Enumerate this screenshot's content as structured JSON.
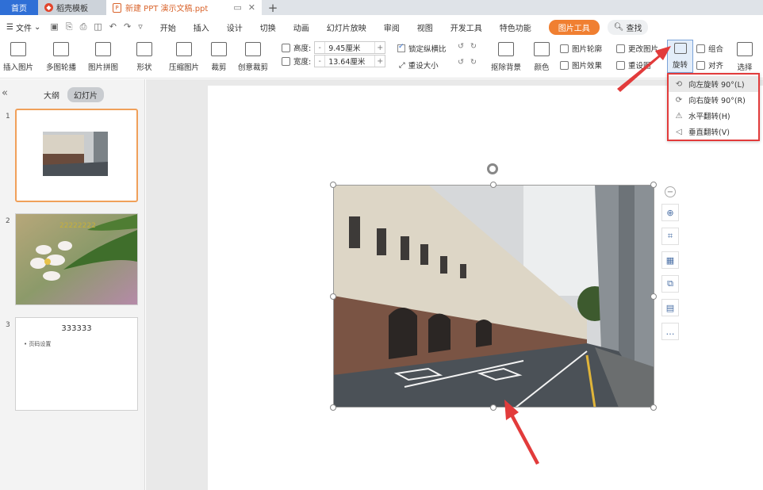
{
  "tabs": {
    "home": "首页",
    "template": "稻壳模板",
    "doc": "新建 PPT 演示文稿.ppt"
  },
  "menu": {
    "file": "文件",
    "items": [
      "开始",
      "插入",
      "设计",
      "切换",
      "动画",
      "幻灯片放映",
      "审阅",
      "视图",
      "开发工具",
      "特色功能"
    ],
    "picture_tools": "图片工具",
    "search": "查找"
  },
  "ribbon": {
    "insert_picture": "插入图片",
    "multi_outline": "多图轮播",
    "picture_collage": "图片拼图",
    "shape": "形状",
    "compress": "压缩图片",
    "crop": "裁剪",
    "creative_crop": "创意裁剪",
    "height_label": "高度:",
    "height_value": "9.45厘米",
    "width_label": "宽度:",
    "width_value": "13.64厘米",
    "lock_ratio": "锁定纵横比",
    "reset_size": "重设大小",
    "remove_bg": "抠除背景",
    "color": "颜色",
    "outline": "图片轮廓",
    "effects": "图片效果",
    "change_picture": "更改图片",
    "reset_picture": "重设图",
    "rotate": "旋转",
    "group": "组合",
    "align": "对齐",
    "select": "选择"
  },
  "left_panel": {
    "tab_outline": "大纲",
    "tab_slides": "幻灯片",
    "slides": [
      {
        "num": "1"
      },
      {
        "num": "2",
        "caption": "22222222"
      },
      {
        "num": "3",
        "title": "333333",
        "bullet": "• 页码设置"
      }
    ]
  },
  "rotate_menu": [
    {
      "label": "向左旋转 90°(L)",
      "icon": "rotate-left-icon"
    },
    {
      "label": "向右旋转 90°(R)",
      "icon": "rotate-right-icon"
    },
    {
      "label": "水平翻转(H)",
      "icon": "flip-horizontal-icon"
    },
    {
      "label": "垂直翻转(V)",
      "icon": "flip-vertical-icon"
    }
  ],
  "colors": {
    "accent_blue": "#2f6fd6",
    "picture_tools_orange": "#f07f31",
    "highlight_red": "#e23b3b"
  }
}
